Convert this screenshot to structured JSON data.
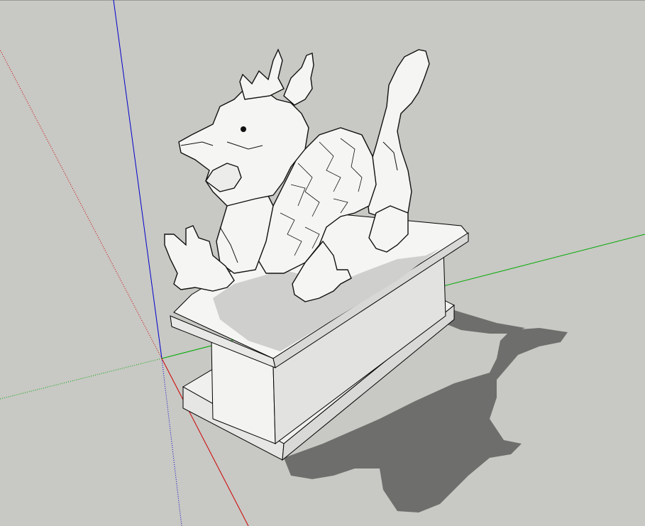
{
  "viewport": {
    "background": "#c8c8c4",
    "axis_colors": {
      "red": "#cc0000",
      "green": "#00aa00",
      "blue": "#0000cc"
    }
  },
  "model": {
    "subject_icon": "dragon-statue-icon",
    "base_icon": "pedestal-icon",
    "shadow_color": "#6e6e6c",
    "surface_color": "#f3f3f1"
  }
}
